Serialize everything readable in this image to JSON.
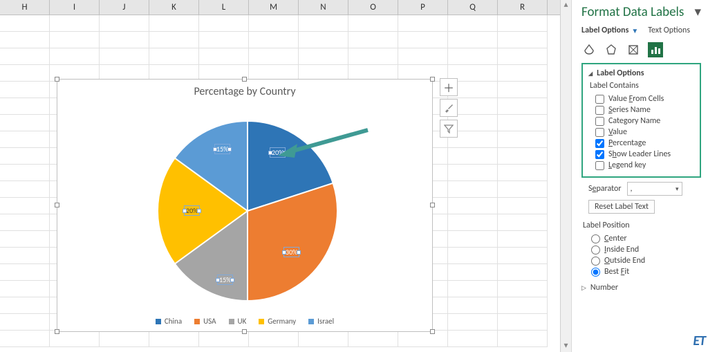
{
  "columns": [
    "H",
    "I",
    "J",
    "K",
    "L",
    "M",
    "N",
    "O",
    "P",
    "Q",
    "R"
  ],
  "chart_data": {
    "type": "pie",
    "title": "Percentage by Country",
    "series": [
      {
        "name": "China",
        "value": 20,
        "color": "#2e75b6",
        "label": "20%"
      },
      {
        "name": "USA",
        "value": 30,
        "color": "#ed7d31",
        "label": "30%"
      },
      {
        "name": "UK",
        "value": 15,
        "color": "#a5a5a5",
        "label": "15%"
      },
      {
        "name": "Germany",
        "value": 20,
        "color": "#ffc000",
        "label": "20%"
      },
      {
        "name": "Israel",
        "value": 15,
        "color": "#5b9bd5",
        "label": "15%"
      }
    ]
  },
  "chart_buttons": {
    "plus": "+",
    "brush": "brush",
    "filter": "filter"
  },
  "pane": {
    "title": "Format Data Labels",
    "tab_label_options": "Label Options",
    "tab_text_options": "Text Options",
    "section_label_options": "Label Options",
    "label_contains": "Label Contains",
    "cb_value_from_cells": "Value From Cells",
    "cb_series_name": "Series Name",
    "cb_category_name": "Category Name",
    "cb_value": "Value",
    "cb_percentage": "Percentage",
    "cb_leader_lines": "Show Leader Lines",
    "cb_legend_key": "Legend key",
    "separator_label": "Separator",
    "separator_value": ",",
    "reset_btn": "Reset Label Text",
    "label_position": "Label Position",
    "rb_center": "Center",
    "rb_inside_end": "Inside End",
    "rb_outside_end": "Outside End",
    "rb_best_fit": "Best Fit",
    "section_number": "Number"
  },
  "logo": "ET"
}
